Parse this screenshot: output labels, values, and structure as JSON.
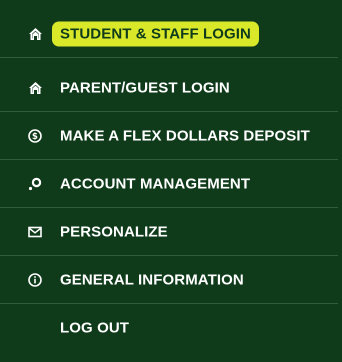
{
  "menu": {
    "items": [
      {
        "label": "STUDENT & STAFF LOGIN",
        "icon": "home-icon",
        "active": true
      },
      {
        "label": "PARENT/GUEST LOGIN",
        "icon": "home-icon",
        "active": false
      },
      {
        "label": "MAKE A FLEX DOLLARS DEPOSIT",
        "icon": "dollar-coin-icon",
        "active": false
      },
      {
        "label": "ACCOUNT MANAGEMENT",
        "icon": "gear-key-icon",
        "active": false
      },
      {
        "label": "PERSONALIZE",
        "icon": "envelope-icon",
        "active": false
      },
      {
        "label": "GENERAL INFORMATION",
        "icon": "info-icon",
        "active": false
      },
      {
        "label": "LOG OUT",
        "icon": "",
        "active": false
      }
    ]
  },
  "colors": {
    "background": "#0f3b1b",
    "highlight": "#d9e92a",
    "text": "#ffffff"
  }
}
